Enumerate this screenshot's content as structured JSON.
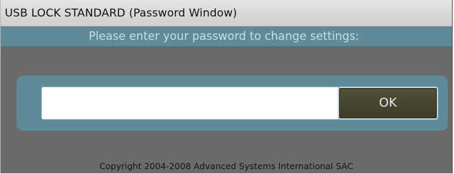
{
  "window": {
    "title": "USB LOCK STANDARD (Password Window)"
  },
  "prompt": {
    "text": "Please enter your password to change settings:"
  },
  "password": {
    "value": "",
    "placeholder": ""
  },
  "ok_button": {
    "label": "OK"
  },
  "footer": {
    "copyright": "Copyright 2004-2008 Advanced Systems International SAC"
  },
  "colors": {
    "window_background": "#6b6b6b",
    "accent_bar": "#5f8a98",
    "prompt_text": "#c6dee6",
    "button_background": "#4a4830",
    "button_border": "#bcd8e0"
  }
}
